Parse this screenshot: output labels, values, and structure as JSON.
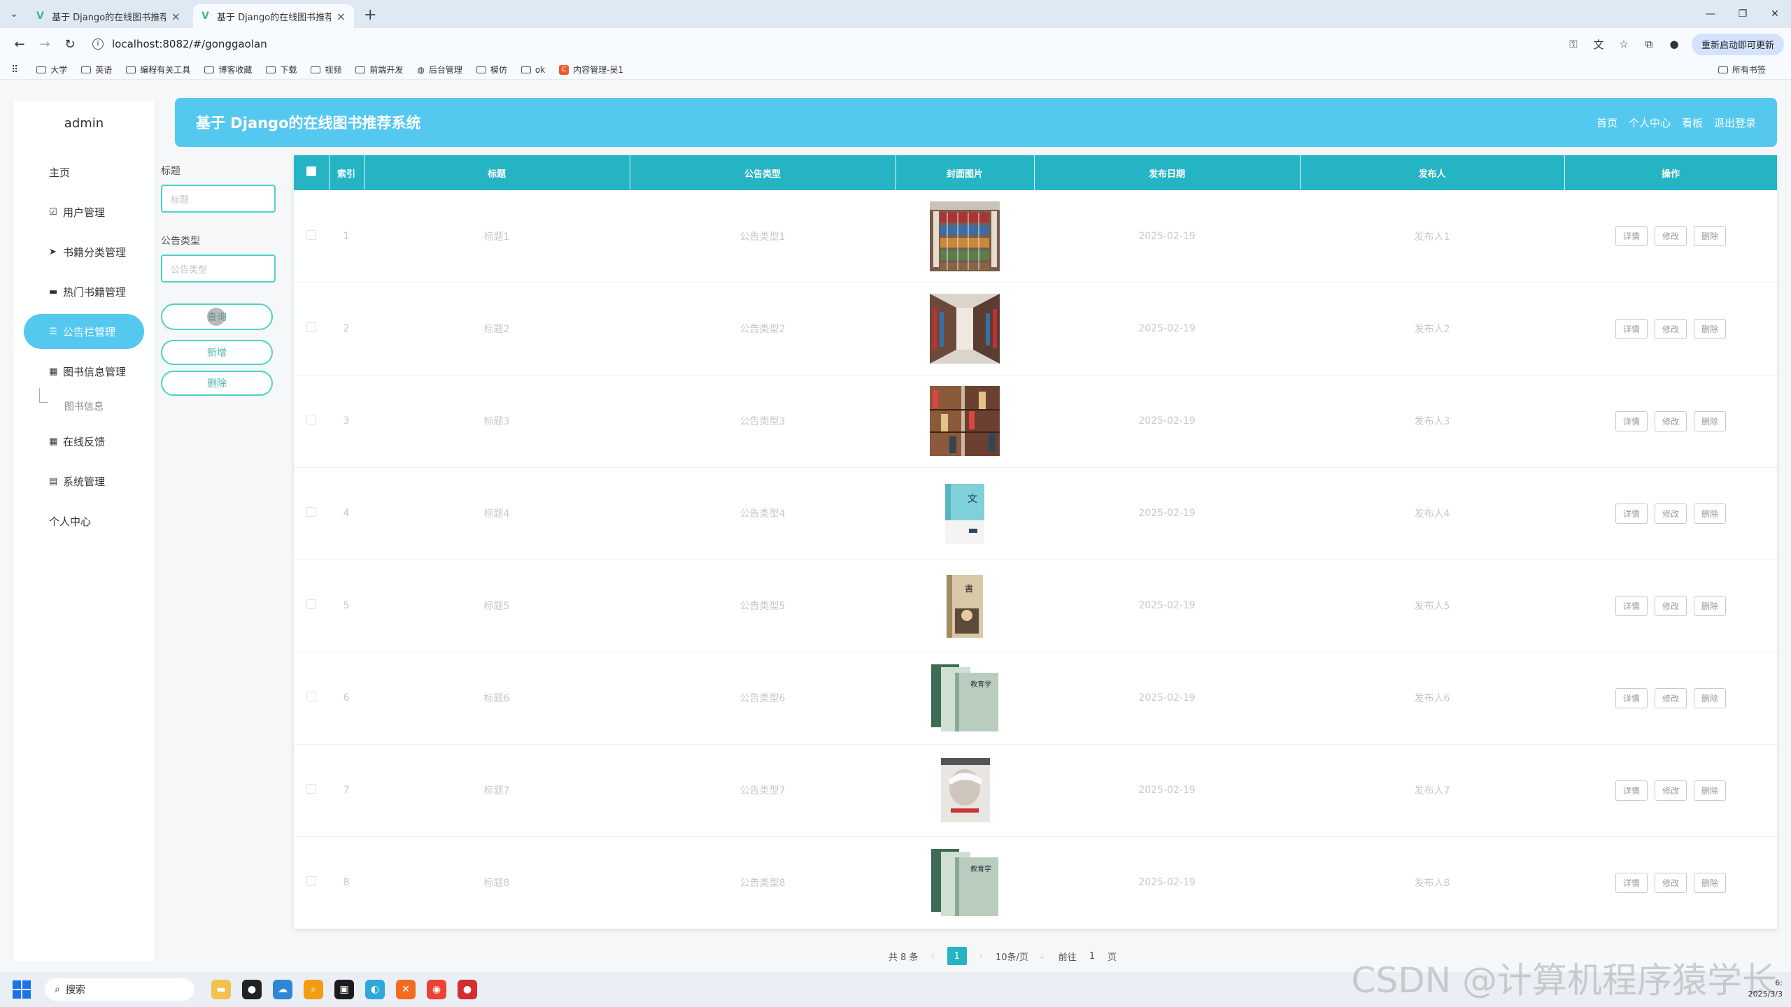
{
  "browser": {
    "tabs": [
      {
        "title": "基于 Django的在线图书推荐系",
        "active": false
      },
      {
        "title": "基于 Django的在线图书推荐系",
        "active": true
      }
    ],
    "url": "localhost:8082/#/gonggaolan",
    "update_label": "重新启动即可更新",
    "bookmarks": [
      "大学",
      "英语",
      "编程有关工具",
      "博客收藏",
      "下载",
      "视频",
      "前端开发",
      "后台管理",
      "模仿",
      "ok",
      "内容管理-吴1"
    ],
    "all_bookmarks": "所有书签"
  },
  "sidebar": {
    "user": "admin",
    "items": [
      {
        "label": "主页",
        "icon": ""
      },
      {
        "label": "用户管理",
        "icon": "☑"
      },
      {
        "label": "书籍分类管理",
        "icon": "➤"
      },
      {
        "label": "热门书籍管理",
        "icon": "▬"
      },
      {
        "label": "公告栏管理",
        "icon": "☰"
      },
      {
        "label": "图书信息管理",
        "icon": "▦"
      },
      {
        "label": "在线反馈",
        "icon": "▦"
      },
      {
        "label": "系统管理",
        "icon": "▤"
      },
      {
        "label": "个人中心",
        "icon": ""
      }
    ],
    "sub_item": "图书信息"
  },
  "filter": {
    "title_label": "标题",
    "title_placeholder": "标题",
    "type_label": "公告类型",
    "type_placeholder": "公告类型",
    "query_btn": "查询",
    "add_btn": "新增",
    "delete_btn": "删除"
  },
  "header": {
    "title": "基于 Django的在线图书推荐系统",
    "nav": [
      "首页",
      "个人中心",
      "看板",
      "退出登录"
    ]
  },
  "table": {
    "columns": [
      "索引",
      "标题",
      "公告类型",
      "封面图片",
      "发布日期",
      "发布人",
      "操作"
    ],
    "rows": [
      {
        "index": "1",
        "title": "标题1",
        "type": "公告类型1",
        "date": "2025-02-19",
        "publisher": "发布人1"
      },
      {
        "index": "2",
        "title": "标题2",
        "type": "公告类型2",
        "date": "2025-02-19",
        "publisher": "发布人2"
      },
      {
        "index": "3",
        "title": "标题3",
        "type": "公告类型3",
        "date": "2025-02-19",
        "publisher": "发布人3"
      },
      {
        "index": "4",
        "title": "标题4",
        "type": "公告类型4",
        "date": "2025-02-19",
        "publisher": "发布人4"
      },
      {
        "index": "5",
        "title": "标题5",
        "type": "公告类型5",
        "date": "2025-02-19",
        "publisher": "发布人5"
      },
      {
        "index": "6",
        "title": "标题6",
        "type": "公告类型6",
        "date": "2025-02-19",
        "publisher": "发布人6"
      },
      {
        "index": "7",
        "title": "标题7",
        "type": "公告类型7",
        "date": "2025-02-19",
        "publisher": "发布人7"
      },
      {
        "index": "8",
        "title": "标题8",
        "type": "公告类型8",
        "date": "2025-02-19",
        "publisher": "发布人8"
      }
    ],
    "actions": {
      "detail": "详情",
      "edit": "修改",
      "delete": "删除"
    }
  },
  "pager": {
    "total": "共 8 条",
    "current": "1",
    "page_size": "10条/页",
    "goto_prefix": "前往",
    "goto_value": "1",
    "goto_suffix": "页"
  },
  "taskbar": {
    "search": "搜索",
    "watermark": "CSDN @计算机程序猿学长",
    "time": "6:",
    "date": "2025/3/3"
  },
  "colors": {
    "accent": "#55c8f0",
    "table_header": "#25b4c4",
    "button_border": "#4fd1c5"
  }
}
